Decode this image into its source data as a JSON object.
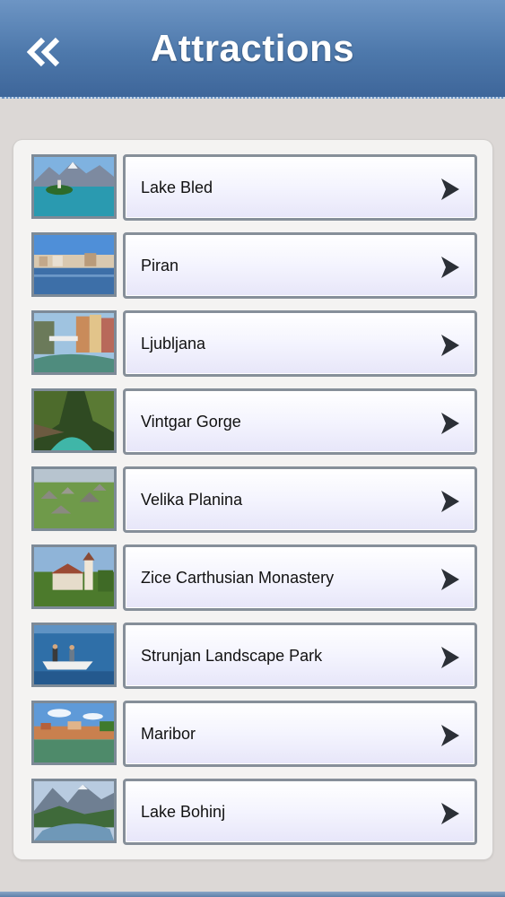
{
  "header": {
    "title": "Attractions",
    "back_icon": "double-chevron-left-icon"
  },
  "attractions": [
    {
      "label": "Lake Bled",
      "thumbnail": "lake-bled-photo"
    },
    {
      "label": "Piran",
      "thumbnail": "piran-photo"
    },
    {
      "label": "Ljubljana",
      "thumbnail": "ljubljana-photo"
    },
    {
      "label": "Vintgar Gorge",
      "thumbnail": "vintgar-gorge-photo"
    },
    {
      "label": "Velika Planina",
      "thumbnail": "velika-planina-photo"
    },
    {
      "label": "Zice Carthusian Monastery",
      "thumbnail": "zice-monastery-photo"
    },
    {
      "label": "Strunjan Landscape Park",
      "thumbnail": "strunjan-park-photo"
    },
    {
      "label": "Maribor",
      "thumbnail": "maribor-photo"
    },
    {
      "label": "Lake Bohinj",
      "thumbnail": "lake-bohinj-photo"
    }
  ],
  "colors": {
    "header": "#4d78ab",
    "background": "#dcd8d6",
    "panel": "#f4f3f2",
    "chevron": "#2b2f36"
  }
}
